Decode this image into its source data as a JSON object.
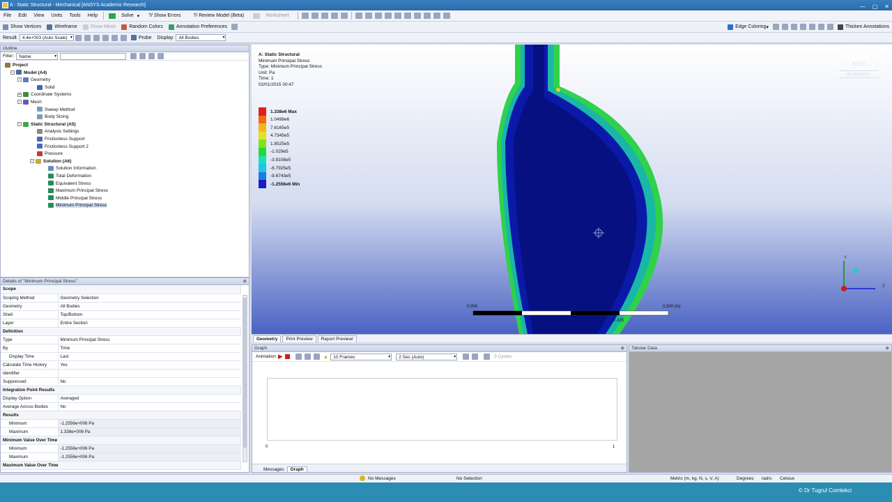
{
  "window": {
    "title": "A : Static Structural - Mechanical [ANSYS Academic Research]"
  },
  "menu": [
    "File",
    "Edit",
    "View",
    "Units",
    "Tools",
    "Help"
  ],
  "toolbar1": {
    "solve": "Solve",
    "show_errors": "?/ Show Errors",
    "review_model": "?/ Review Model (Beta)",
    "worksheet": "Worksheet"
  },
  "toolbar2": {
    "show_vertices": "Show Vertices",
    "wireframe": "Wireframe",
    "show_mesh": "Show Mesh",
    "random_colors": "Random Colors",
    "annotation_prefs": "Annotation Preferences",
    "edge_coloring": "Edge Coloring",
    "thicken": "Thicken Annotations"
  },
  "toolbar3": {
    "result_label": "Result",
    "scale": "4.4e+003 (Auto Scale)",
    "probe": "Probe",
    "display_label": "Display",
    "display_value": "All Bodies"
  },
  "outline": {
    "title": "Outline",
    "filter_label": "Filter:",
    "filter_value": "Name",
    "items": [
      {
        "label": "Project",
        "bold": true
      },
      {
        "label": "Model (A4)",
        "bold": true
      },
      {
        "label": "Geometry"
      },
      {
        "label": "Solid"
      },
      {
        "label": "Coordinate Systems"
      },
      {
        "label": "Mesh"
      },
      {
        "label": "Sweep Method"
      },
      {
        "label": "Body Sizing"
      },
      {
        "label": "Static Structural (A5)",
        "bold": true
      },
      {
        "label": "Analysis Settings"
      },
      {
        "label": "Frictionless Support"
      },
      {
        "label": "Frictionless Support 2"
      },
      {
        "label": "Pressure"
      },
      {
        "label": "Solution (A6)",
        "bold": true
      },
      {
        "label": "Solution Information"
      },
      {
        "label": "Total Deformation"
      },
      {
        "label": "Equivalent Stress"
      },
      {
        "label": "Maximum Principal Stress"
      },
      {
        "label": "Middle Principal Stress"
      },
      {
        "label": "Minimum Principal Stress"
      }
    ]
  },
  "details": {
    "title": "Details of \"Minimum Principal Stress\"",
    "rows": [
      {
        "k": "Scope",
        "sec": true
      },
      {
        "k": "Scoping Method",
        "v": "Geometry Selection"
      },
      {
        "k": "Geometry",
        "v": "All Bodies"
      },
      {
        "k": "Shell",
        "v": "Top/Bottom"
      },
      {
        "k": "Layer",
        "v": "Entire Section"
      },
      {
        "k": "Definition",
        "sec": true
      },
      {
        "k": "Type",
        "v": "Minimum Principal Stress"
      },
      {
        "k": "By",
        "v": "Time"
      },
      {
        "k": "Display Time",
        "v": "Last"
      },
      {
        "k": "Calculate Time History",
        "v": "Yes"
      },
      {
        "k": "Identifier",
        "v": ""
      },
      {
        "k": "Suppressed",
        "v": "No"
      },
      {
        "k": "Integration Point Results",
        "sec": true
      },
      {
        "k": "Display Option",
        "v": "Averaged"
      },
      {
        "k": "Average Across Bodies",
        "v": "No"
      },
      {
        "k": "Results",
        "sec": true
      },
      {
        "k": "Minimum",
        "v": "-1.2556e+006 Pa",
        "ro": true
      },
      {
        "k": "Maximum",
        "v": "1.338e+006 Pa",
        "ro": true
      },
      {
        "k": "Minimum Value Over Time",
        "sec": true
      },
      {
        "k": "Minimum",
        "v": "-1.2556e+006 Pa",
        "ro": true
      },
      {
        "k": "Maximum",
        "v": "-1.2556e+006 Pa",
        "ro": true
      },
      {
        "k": "Maximum Value Over Time",
        "sec": true
      }
    ]
  },
  "viewport": {
    "info": [
      "A: Static Structural",
      "Minimum Principal Stress",
      "Type: Minimum Principal Stress",
      "Unit: Pa",
      "Time: 1",
      "02/01/2015 00:47"
    ],
    "brand": "ANSYS",
    "version": "R15.0",
    "edition": "Academic",
    "legend": [
      {
        "label": "1.338e6 Max",
        "color": "#e0201c",
        "bold": true
      },
      {
        "label": "1.0498e6",
        "color": "#f46a10"
      },
      {
        "label": "7.6165e5",
        "color": "#f2b81b"
      },
      {
        "label": "4.7345e5",
        "color": "#e3e31c"
      },
      {
        "label": "1.8525e5",
        "color": "#7ee41c"
      },
      {
        "label": "-1.029e5",
        "color": "#1fdc3c"
      },
      {
        "label": "-3.9108e5",
        "color": "#1be0b6"
      },
      {
        "label": "-6.7925e5",
        "color": "#1bc6e6"
      },
      {
        "label": "-9.6743e5",
        "color": "#1a7ee6"
      },
      {
        "label": "-1.2556e6 Min",
        "color": "#1a1ac6",
        "bold": true
      }
    ],
    "scale": {
      "left": "0.000",
      "right": "0.300 (m)",
      "mid": "0.225"
    }
  },
  "view_tabs": [
    "Geometry",
    "Print Preview",
    "Report Preview/"
  ],
  "graph": {
    "title": "Graph",
    "animation": "Animation",
    "frames": "10 Frames",
    "duration": "2 Sec (Auto)",
    "cycles": "3 Cycles",
    "x0": "0",
    "x1": "1"
  },
  "graph_tabs": [
    "Messages",
    "Graph"
  ],
  "tabular": {
    "title": "Tabular Data"
  },
  "status": {
    "messages": "No Messages",
    "selection": "No Selection",
    "units": "Metric (m, kg, N, s, V, A)",
    "angle": "Degrees",
    "rate": "rad/s",
    "temp": "Celsius"
  },
  "watermark": "© Dr Tugrul Comlekci"
}
